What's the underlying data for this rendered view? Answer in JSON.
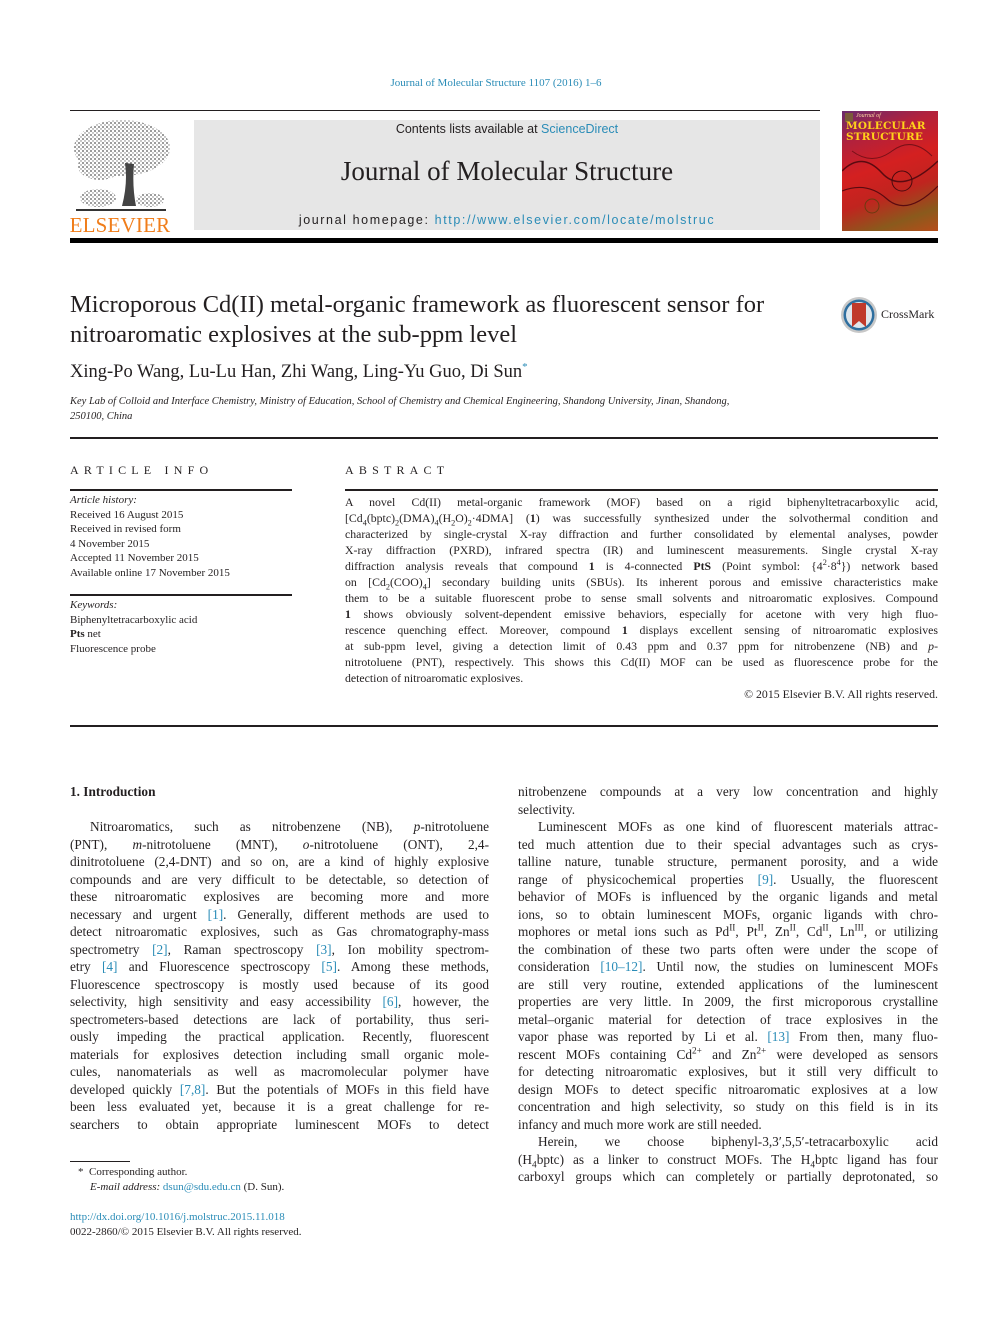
{
  "running_header": "Journal of Molecular Structure 1107 (2016) 1–6",
  "masthead": {
    "publisher_logo_text": "ELSEVIER",
    "contents_prefix": "Contents lists available at ",
    "contents_link": "ScienceDirect",
    "journal_title": "Journal of Molecular Structure",
    "homepage_prefix": "journal homepage: ",
    "homepage_link": "http://www.elsevier.com/locate/molstruc",
    "cover_line1": "MOLECULAR",
    "cover_line2": "STRUCTURE",
    "cover_script": "Journal of"
  },
  "article": {
    "title_line1": "Microporous Cd(II) metal-organic framework as fluorescent sensor for",
    "title_line2": "nitroaromatic explosives at the sub-ppm level",
    "crossmark_label": "CrossMark",
    "authors": "Xing-Po Wang, Lu-Lu Han, Zhi Wang, Ling-Yu Guo, Di Sun",
    "corresponding_mark": "*",
    "affiliation_line1": "Key Lab of Colloid and Interface Chemistry, Ministry of Education, School of Chemistry and Chemical Engineering, Shandong University, Jinan, Shandong,",
    "affiliation_line2": "250100, China"
  },
  "article_info": {
    "heading": "ARTICLE INFO",
    "history_label": "Article history:",
    "history": [
      "Received 16 August 2015",
      "Received in revised form",
      "4 November 2015",
      "Accepted 11 November 2015",
      "Available online 17 November 2015"
    ],
    "keywords_label": "Keywords:",
    "keywords": [
      "Biphenyltetracarboxylic acid",
      "Pts net",
      "Fluorescence probe"
    ]
  },
  "abstract": {
    "heading": "ABSTRACT",
    "lines": [
      "A novel Cd(II) metal-organic framework (MOF) based on a rigid biphenyltetracarboxylic acid,",
      "[Cd4(bptc)2(DMA)4(H2O)2·4DMA] (1) was successfully synthesized under the solvothermal condition and",
      "characterized by single-crystal X-ray diffraction and further consolidated by elemental analyses, powder",
      "X-ray diffraction (PXRD), infrared spectra (IR) and luminescent measurements. Single crystal X-ray",
      "diffraction analysis reveals that compound 1 is 4-connected PtS (Point symbol: {4^2·8^4}) network based",
      "on [Cd2(COO)4] secondary building units (SBUs). Its inherent porous and emissive characteristics make",
      "them to be a suitable fluorescent probe to sense small solvents and nitroaromatic explosives. Compound",
      "1 shows obviously solvent-dependent emissive behaviors, especially for acetone with very high fluo-",
      "rescence quenching effect. Moreover, compound 1 displays excellent sensing of nitroaromatic explosives",
      "at sub-ppm level, giving a detection limit of 0.43 ppm and 0.37 ppm for nitrobenzene (NB) and p-",
      "nitrotoluene (PNT), respectively. This shows this Cd(II) MOF can be used as fluorescence probe for the",
      "detection of nitroaromatic explosives."
    ],
    "copyright": "© 2015 Elsevier B.V. All rights reserved."
  },
  "introduction": {
    "heading": "1.  Introduction",
    "left_column": [
      "Nitroaromatics, such as nitrobenzene (NB), p-nitrotoluene",
      "(PNT), m-nitrotoluene (MNT), o-nitrotoluene (ONT), 2,4-",
      "dinitrotoluene (2,4-DNT) and so on, are a kind of highly explosive",
      "compounds and are very difficult to be detectable, so detection of",
      "these nitroaromatic explosives are becoming more and more",
      "necessary and urgent [1]. Generally, different methods are used to",
      "detect nitroaromatic explosives, such as Gas chromatography-mass",
      "spectrometry [2], Raman spectroscopy [3], Ion mobility spectrom-",
      "etry [4] and Fluorescence spectroscopy [5]. Among these methods,",
      "Fluorescence spectroscopy is mostly used because of its good",
      "selectivity, high sensitivity and easy accessibility [6], however, the",
      "spectrometers-based detections are lack of portability, thus seri-",
      "ously impeding the practical application. Recently, fluorescent",
      "materials for explosives detection including small organic mole-",
      "cules, nanomaterials as well as macromolecular polymer have",
      "developed quickly [7,8]. But the potentials of MOFs in this field have",
      "been less evaluated yet, because it is a great challenge for re-",
      "searchers to obtain appropriate luminescent MOFs to detect"
    ],
    "right_column": [
      "nitrobenzene compounds at a very low concentration and highly",
      "selectivity.",
      "Luminescent MOFs as one kind of fluorescent materials attrac-",
      "ted much attention due to their special advantages such as crys-",
      "talline nature, tunable structure, permanent porosity, and a wide",
      "range of physicochemical properties [9]. Usually, the fluorescent",
      "behavior of MOFs is influenced by the organic ligands and metal",
      "ions, so to obtain luminescent MOFs, organic ligands with chro-",
      "mophores or metal ions such as Pd^II, Pt^II, Zn^II, Cd^II, Ln^III, or utilizing",
      "the combination of these two parts often were under the scope of",
      "consideration [10–12]. Until now, the studies on luminescent MOFs",
      "are still very routine, extended applications of the luminescent",
      "properties are very little. In 2009, the first microporous crystalline",
      "metal–organic material for detection of trace explosives in the",
      "vapor phase was reported by Li et al. [13] From then, many fluo-",
      "rescent MOFs containing Cd^2+ and Zn^2+ were developed as sensors",
      "for detecting nitroaromatic explosives, but it still very difficult to",
      "design MOFs to detect specific nitroaromatic explosives at a low",
      "concentration and high selectivity, so study on this field is in its",
      "infancy and much more work are still needed.",
      "Herein, we choose biphenyl-3,3′,5,5′-tetracarboxylic acid",
      "(H4bptc) as a linker to construct MOFs. The H4bptc ligand has four",
      "carboxyl groups which can completely or partially deprotonated, so"
    ]
  },
  "footnotes": {
    "corresponding_mark": "*",
    "corresponding_label": "Corresponding author.",
    "email_label": "E-mail address: ",
    "email": "dsun@sdu.edu.cn",
    "email_suffix": " (D. Sun).",
    "doi": "http://dx.doi.org/10.1016/j.molstruc.2015.11.018",
    "issn_copyright": "0022-2860/© 2015 Elsevier B.V. All rights reserved."
  },
  "colors": {
    "link": "#2a8cb7",
    "elsevier_orange": "#f07d1a",
    "masthead_bg": "#e6e6e6",
    "text": "#231f20"
  }
}
